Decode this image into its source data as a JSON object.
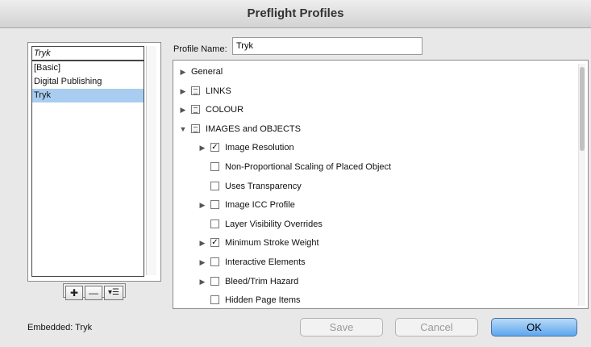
{
  "window": {
    "title": "Preflight Profiles"
  },
  "profiles": {
    "header": "Tryk",
    "items": [
      "[Basic]",
      "Digital Publishing",
      "Tryk"
    ],
    "selected_index": 2
  },
  "toolbar": {
    "new_glyph": "✚",
    "delete_glyph": "—",
    "menu_glyph": "▾☰"
  },
  "profile_name": {
    "label": "Profile Name:",
    "value": "Tryk"
  },
  "tree": [
    {
      "label": "General",
      "expandable": true,
      "expanded": false,
      "checkbox": "none",
      "level": 0
    },
    {
      "label": "LINKS",
      "expandable": true,
      "expanded": false,
      "checkbox": "mixed",
      "level": 0
    },
    {
      "label": "COLOUR",
      "expandable": true,
      "expanded": false,
      "checkbox": "mixed",
      "level": 0
    },
    {
      "label": "IMAGES and OBJECTS",
      "expandable": true,
      "expanded": true,
      "checkbox": "mixed",
      "level": 0
    },
    {
      "label": "Image Resolution",
      "expandable": true,
      "expanded": false,
      "checkbox": "checked",
      "level": 1
    },
    {
      "label": "Non-Proportional Scaling of Placed Object",
      "expandable": false,
      "checkbox": "unchecked",
      "level": 1
    },
    {
      "label": "Uses Transparency",
      "expandable": false,
      "checkbox": "unchecked",
      "level": 1
    },
    {
      "label": "Image ICC Profile",
      "expandable": true,
      "expanded": false,
      "checkbox": "unchecked",
      "level": 1
    },
    {
      "label": "Layer Visibility Overrides",
      "expandable": false,
      "checkbox": "unchecked",
      "level": 1
    },
    {
      "label": "Minimum Stroke Weight",
      "expandable": true,
      "expanded": false,
      "checkbox": "checked",
      "level": 1
    },
    {
      "label": "Interactive Elements",
      "expandable": true,
      "expanded": false,
      "checkbox": "unchecked",
      "level": 1
    },
    {
      "label": "Bleed/Trim Hazard",
      "expandable": true,
      "expanded": false,
      "checkbox": "unchecked",
      "level": 1
    },
    {
      "label": "Hidden Page Items",
      "expandable": false,
      "checkbox": "unchecked",
      "level": 1
    }
  ],
  "footer": {
    "embedded_label": "Embedded:",
    "embedded_value": "Tryk",
    "save_label": "Save",
    "cancel_label": "Cancel",
    "ok_label": "OK"
  },
  "colors": {
    "selection": "#a9cdf0",
    "ok_button": "#5ea6ee"
  }
}
